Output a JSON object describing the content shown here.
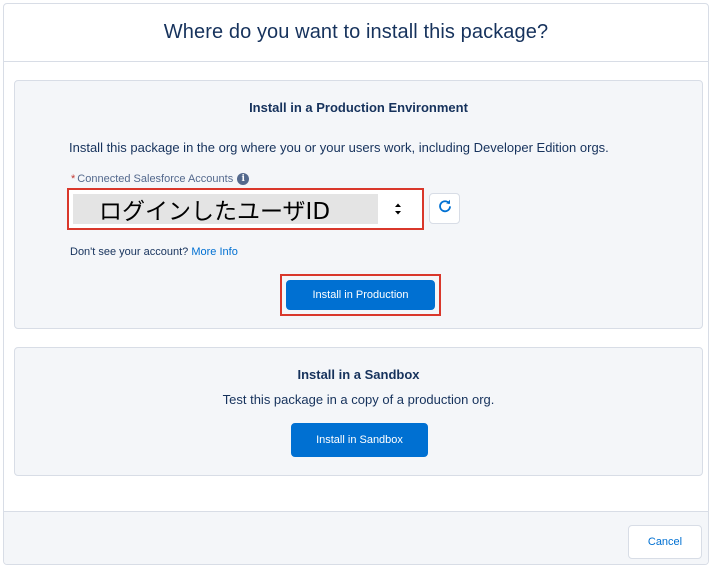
{
  "modal": {
    "title": "Where do you want to install this package?"
  },
  "production": {
    "title": "Install in a Production Environment",
    "description": "Install this package in the org where you or your users work, including Developer Edition orgs.",
    "account_label": "Connected Salesforce Accounts",
    "required_marker": "*",
    "info_icon_glyph": "i",
    "selected_account": "ログインしたユーザID",
    "dont_see_text": "Don't see your account?",
    "more_info_link": "More Info",
    "install_button": "Install in Production"
  },
  "sandbox": {
    "title": "Install in a Sandbox",
    "description": "Test this package in a copy of a production org.",
    "install_button": "Install in Sandbox"
  },
  "footer": {
    "cancel_button": "Cancel"
  },
  "colors": {
    "brand": "#0070d2",
    "highlight": "#d9372b",
    "text": "#16325c",
    "card_bg": "#f4f6f9",
    "border": "#d8dde6"
  },
  "icons": {
    "info": "info-icon",
    "refresh": "refresh-icon",
    "select_arrows": "chevron-up-down-icon"
  }
}
